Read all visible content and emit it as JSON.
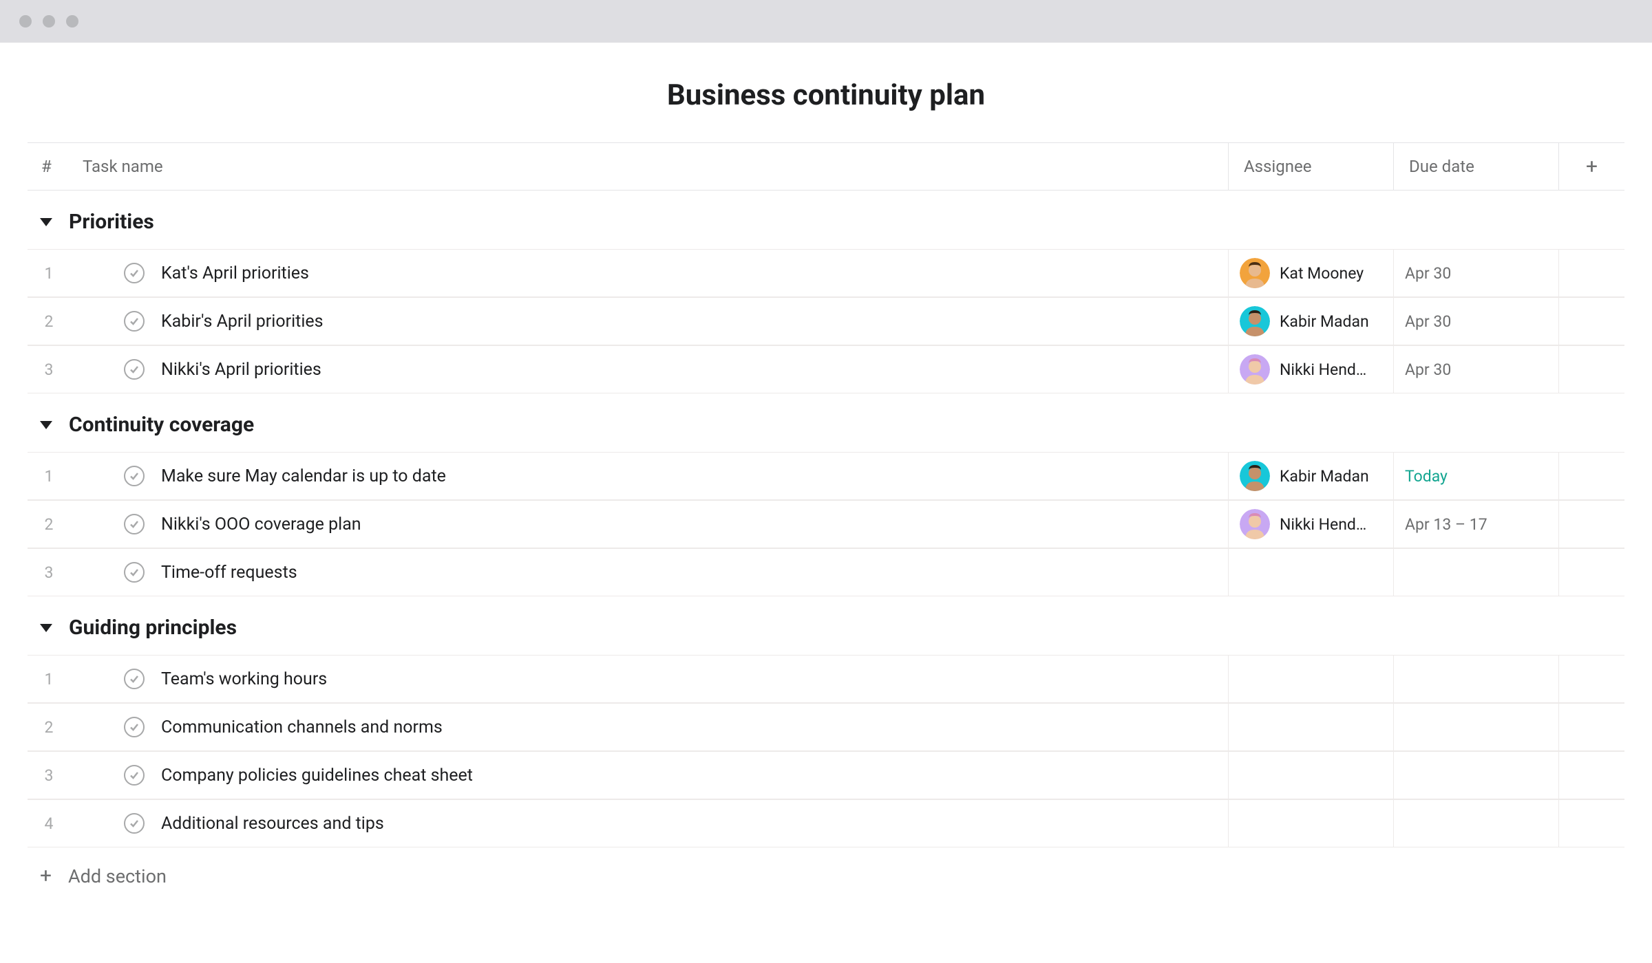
{
  "page_title": "Business continuity plan",
  "columns": {
    "num": "#",
    "name": "Task name",
    "assignee": "Assignee",
    "due": "Due date"
  },
  "sections": [
    {
      "title": "Priorities",
      "tasks": [
        {
          "num": "1",
          "name": "Kat's April priorities",
          "assignee": "Kat Mooney",
          "avatar": "kat",
          "due": "Apr 30",
          "due_today": false
        },
        {
          "num": "2",
          "name": "Kabir's April priorities",
          "assignee": "Kabir Madan",
          "avatar": "kabir",
          "due": "Apr 30",
          "due_today": false
        },
        {
          "num": "3",
          "name": "Nikki's April priorities",
          "assignee": "Nikki Hend…",
          "avatar": "nikki",
          "due": "Apr 30",
          "due_today": false
        }
      ]
    },
    {
      "title": "Continuity coverage",
      "tasks": [
        {
          "num": "1",
          "name": "Make sure May calendar is up to date",
          "assignee": "Kabir Madan",
          "avatar": "kabir",
          "due": "Today",
          "due_today": true
        },
        {
          "num": "2",
          "name": "Nikki's OOO coverage plan",
          "assignee": "Nikki Hend…",
          "avatar": "nikki",
          "due": "Apr 13 – 17",
          "due_today": false
        },
        {
          "num": "3",
          "name": "Time-off requests",
          "assignee": "",
          "avatar": "",
          "due": "",
          "due_today": false
        }
      ]
    },
    {
      "title": "Guiding principles",
      "tasks": [
        {
          "num": "1",
          "name": "Team's working hours",
          "assignee": "",
          "avatar": "",
          "due": "",
          "due_today": false
        },
        {
          "num": "2",
          "name": "Communication channels and norms",
          "assignee": "",
          "avatar": "",
          "due": "",
          "due_today": false
        },
        {
          "num": "3",
          "name": "Company policies guidelines cheat sheet",
          "assignee": "",
          "avatar": "",
          "due": "",
          "due_today": false
        },
        {
          "num": "4",
          "name": "Additional resources and tips",
          "assignee": "",
          "avatar": "",
          "due": "",
          "due_today": false
        }
      ]
    }
  ],
  "avatars": {
    "kat": {
      "bg": "#f2a33c",
      "hair": "#4a2e14",
      "skin": "#e8b98e"
    },
    "kabir": {
      "bg": "#18c7d9",
      "hair": "#2b2016",
      "skin": "#c6916a"
    },
    "nikki": {
      "bg": "#c8a8f3",
      "hair": "#d98bb6",
      "skin": "#f0c9a8"
    }
  },
  "add_section_label": "Add section"
}
